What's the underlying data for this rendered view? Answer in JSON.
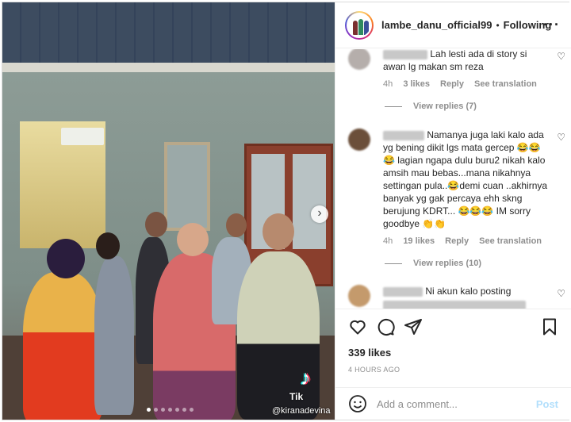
{
  "header": {
    "username": "lambe_danu_official99",
    "separator": "•",
    "follow_status": "Following",
    "more_label": "···"
  },
  "media": {
    "watermark": "@kiranadevina",
    "tiktok_text": "Tik",
    "next_label": "›",
    "slide_count": 7,
    "active_slide": 1
  },
  "comments": [
    {
      "text": "Lah lesti ada di story si awan lg makan sm reza",
      "time": "4h",
      "likes": "3 likes",
      "reply": "Reply",
      "translate": "See translation",
      "view_replies": "View replies (7)"
    },
    {
      "text": "Namanya juga laki kalo ada yg bening dikit lgs mata gercep 😂😂😂 lagian ngapa dulu buru2 nikah kalo amsih mau bebas...mana nikahnya settingan pula..😂demi cuan ..akhirnya banyak yg gak percaya ehh skng berujung KDRT... 😂😂😂 IM sorry goodbye 👏👏",
      "time": "4h",
      "likes": "19 likes",
      "reply": "Reply",
      "translate": "See translation",
      "view_replies": "View replies (10)"
    },
    {
      "text": "Ni akun kalo posting"
    }
  ],
  "footer": {
    "likes": "339 likes",
    "time": "4 HOURS AGO",
    "comment_placeholder": "Add a comment...",
    "post_label": "Post"
  },
  "colors": {
    "link_disabled": "#b2dffc",
    "secondary_text": "#8e8e8e"
  }
}
